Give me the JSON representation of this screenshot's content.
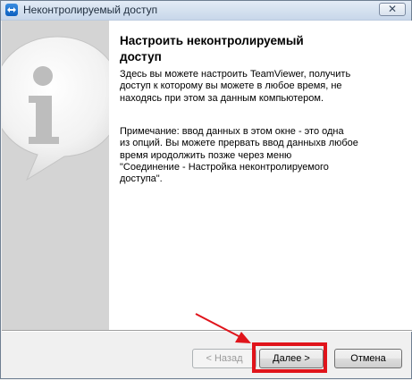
{
  "window": {
    "title": "Неконтролируемый доступ",
    "close_symbol": "✕"
  },
  "content": {
    "heading_line1": "Настроить неконтролируемый",
    "heading_line2": "доступ",
    "paragraph1_lines": [
      "Здесь вы можете настроить TeamViewer, получить",
      "доступ к которому вы можете в любое время, не",
      "находясь при этом за данным компьютером."
    ],
    "paragraph2_lines": [
      "Примечание: ввод данных в этом окне  - это одна",
      "из опций. Вы можете прервать ввод данныхв любое",
      "время иродолжить позже через меню",
      "\"Соединение - Настройка неконтролируемого",
      "доступа\"."
    ]
  },
  "buttons": {
    "back_label": "< Назад",
    "next_label": "Далее >",
    "cancel_label": "Отмена"
  },
  "colors": {
    "highlight": "#e0141b",
    "side_panel": "#d4d4d4"
  },
  "icons": {
    "app": "teamviewer-logo-icon",
    "info": "info-bubble-icon",
    "close": "close-icon",
    "annotation": "red-arrow-annotation"
  }
}
